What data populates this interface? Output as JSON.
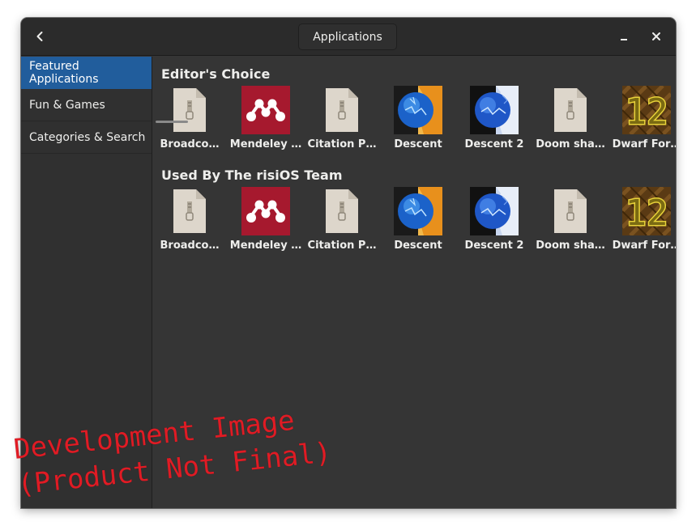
{
  "window": {
    "title": "Applications"
  },
  "sidebar": {
    "items": [
      {
        "label": "Featured Applications",
        "active": true
      },
      {
        "label": "Fun & Games",
        "active": false
      },
      {
        "label": "Categories & Search",
        "active": false
      }
    ]
  },
  "sections": [
    {
      "title": "Editor's Choice",
      "apps": [
        {
          "label": "Broadco…",
          "icon": "archive-icon"
        },
        {
          "label": "Mendeley …",
          "icon": "mendeley-icon"
        },
        {
          "label": "Citation P…",
          "icon": "archive-icon"
        },
        {
          "label": "Descent",
          "icon": "descent-icon"
        },
        {
          "label": "Descent 2",
          "icon": "descent2-icon"
        },
        {
          "label": "Doom sha…",
          "icon": "archive-icon"
        },
        {
          "label": "Dwarf For…",
          "icon": "dwarf-fortress-icon"
        }
      ]
    },
    {
      "title": "Used By The risiOS Team",
      "apps": [
        {
          "label": "Broadco…",
          "icon": "archive-icon"
        },
        {
          "label": "Mendeley …",
          "icon": "mendeley-icon"
        },
        {
          "label": "Citation P…",
          "icon": "archive-icon"
        },
        {
          "label": "Descent",
          "icon": "descent-icon"
        },
        {
          "label": "Descent 2",
          "icon": "descent2-icon"
        },
        {
          "label": "Doom sha…",
          "icon": "archive-icon"
        },
        {
          "label": "Dwarf For…",
          "icon": "dwarf-fortress-icon"
        }
      ]
    }
  ],
  "watermark": {
    "line1": "Development Image",
    "line2": "(Product Not Final)"
  },
  "colors": {
    "accent": "#215d9c",
    "watermark": "#e01b24",
    "background": "#353535"
  }
}
